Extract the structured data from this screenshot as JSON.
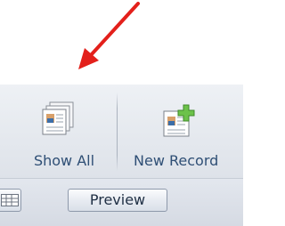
{
  "ribbon": {
    "show_all": {
      "label": "Show All",
      "icon": "show-all-icon"
    },
    "new_record": {
      "label": "New Record",
      "icon": "new-record-icon"
    }
  },
  "toolbar": {
    "grid_button": {
      "icon": "grid-icon"
    },
    "preview_label": "Preview"
  },
  "annotation": {
    "icon": "red-arrow-icon",
    "color": "#e3201b"
  },
  "colors": {
    "label_text": "#2f4f75",
    "ribbon_bg": "#e3e7ed",
    "button_border": "#8e99ab"
  }
}
